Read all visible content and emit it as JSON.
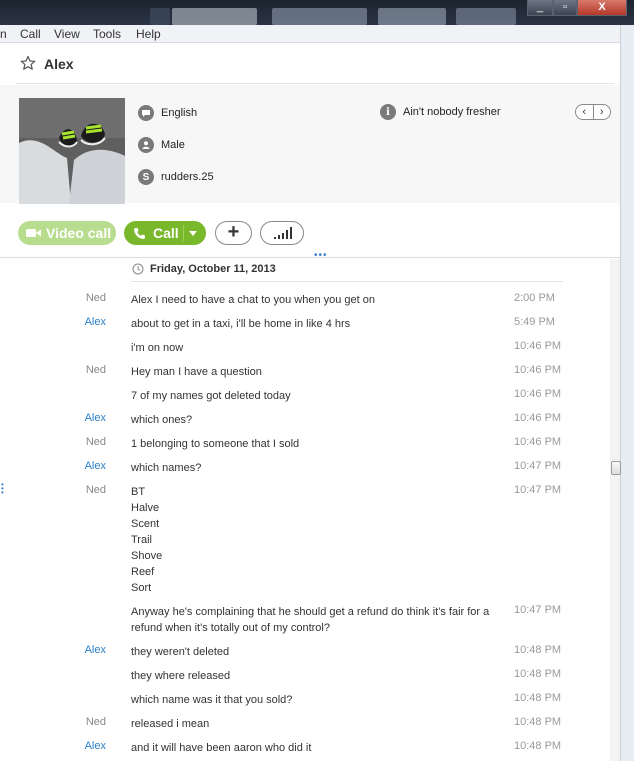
{
  "window": {
    "minimize_glyph": "_",
    "maximize_glyph": "▫",
    "close_glyph": "X"
  },
  "menu": {
    "items": [
      "n",
      "Call",
      "View",
      "Tools",
      "Help"
    ]
  },
  "contact": {
    "name": "Alex",
    "language": "English",
    "gender": "Male",
    "username": "rudders.25",
    "mood": "Ain't nobody fresher"
  },
  "actions": {
    "video_call": "Video call",
    "call": "Call",
    "add": "+"
  },
  "conversation": {
    "date": "Friday, October 11, 2013",
    "messages": [
      {
        "sender": "Ned",
        "text": "Alex I need to have a chat to you when you get on",
        "time": "2:00 PM"
      },
      {
        "sender": "Alex",
        "text": "about to get in a taxi, i'll be home in like 4 hrs",
        "time": "5:49 PM"
      },
      {
        "sender": "",
        "text": "i'm on now",
        "time": "10:46 PM"
      },
      {
        "sender": "Ned",
        "text": "Hey man I have a question",
        "time": "10:46 PM"
      },
      {
        "sender": "",
        "text": "7 of my names got deleted today",
        "time": "10:46 PM"
      },
      {
        "sender": "Alex",
        "text": "which ones?",
        "time": "10:46 PM"
      },
      {
        "sender": "Ned",
        "text": "1 belonging to someone that I sold",
        "time": "10:46 PM"
      },
      {
        "sender": "Alex",
        "text": "which names?",
        "time": "10:47 PM"
      },
      {
        "sender": "Ned",
        "text": "BT\nHalve\nScent\nTrail\nShove\nReef\nSort",
        "time": "10:47 PM"
      },
      {
        "sender": "",
        "text": "Anyway he's complaining that he should get a refund do think it's fair for a refund when it's totally out of my control?",
        "time": "10:47 PM"
      },
      {
        "sender": "Alex",
        "text": "they weren't deleted",
        "time": "10:48 PM"
      },
      {
        "sender": "",
        "text": "they where released",
        "time": "10:48 PM"
      },
      {
        "sender": "",
        "text": "which name was it that you sold?",
        "time": "10:48 PM"
      },
      {
        "sender": "Ned",
        "text": "released i mean",
        "time": "10:48 PM"
      },
      {
        "sender": "Alex",
        "text": "and it will have been aaron who did it",
        "time": "10:48 PM"
      }
    ]
  },
  "colors": {
    "call_green": "#79b82a",
    "video_green_disabled": "#b9dd8e",
    "alex_blue": "#2e7fc2",
    "sender_grey": "#888888"
  }
}
